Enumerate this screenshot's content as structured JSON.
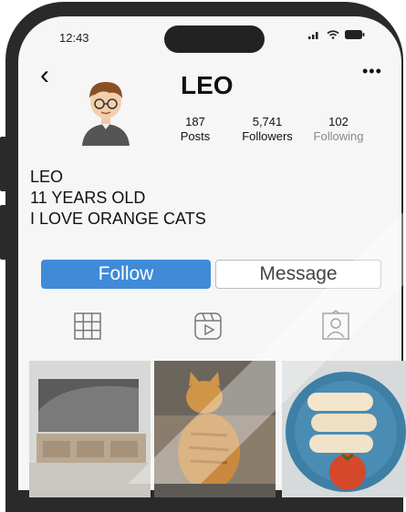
{
  "status": {
    "time": "12:43"
  },
  "profile": {
    "username": "LEO",
    "stats": [
      {
        "value": "187",
        "label": "Posts"
      },
      {
        "value": "5,741",
        "label": "Followers"
      },
      {
        "value": "102",
        "label": "Following"
      }
    ],
    "bio": [
      "LEO",
      "11 YEARS OLD",
      "I LOVE ORANGE CATS"
    ]
  },
  "actions": {
    "follow_label": "Follow",
    "message_label": "Message"
  },
  "tabs": [
    "grid-icon",
    "reels-icon",
    "tagged-icon"
  ],
  "grid": [
    "living-room-tv-photo",
    "orange-cat-photo",
    "food-plate-photo"
  ],
  "colors": {
    "follow": "#3f8bd8",
    "frame": "#2a2a2a",
    "screen": "#f6f6f6"
  }
}
